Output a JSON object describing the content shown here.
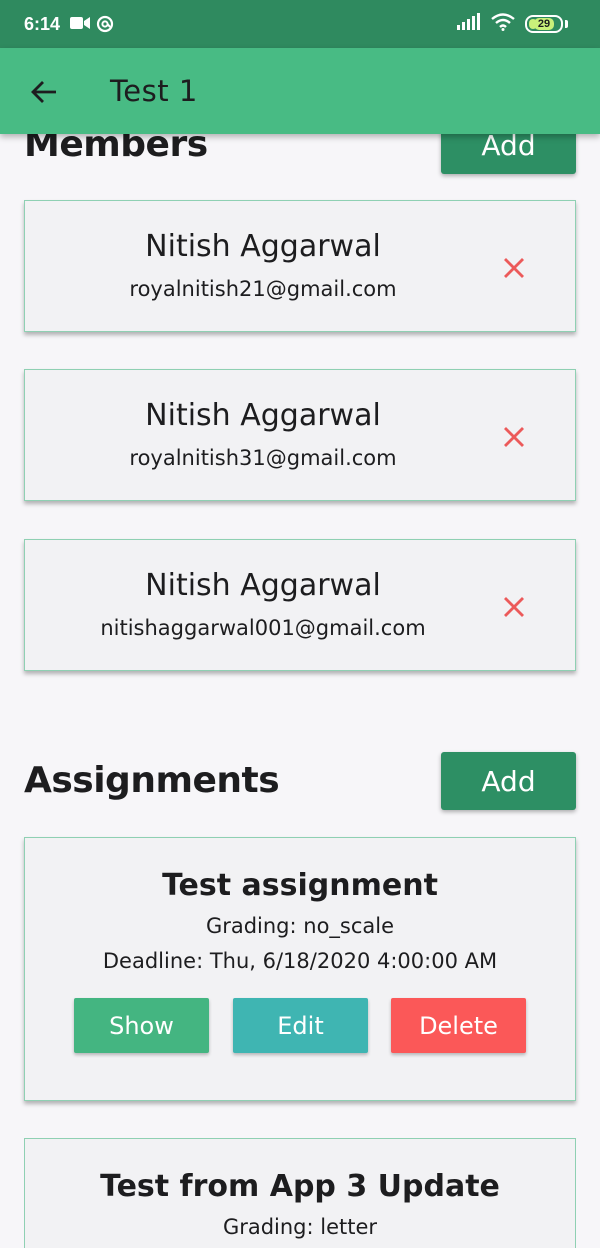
{
  "status_bar": {
    "time": "6:14",
    "battery_level": "29",
    "icons": [
      "video-camera-icon",
      "at-sign-icon",
      "signal-icon",
      "wifi-icon",
      "battery-icon"
    ]
  },
  "app_bar": {
    "back_icon": "arrow-left-icon",
    "title": "Test  1"
  },
  "members": {
    "title": "Members",
    "add_label": "Add",
    "items": [
      {
        "name": "Nitish Aggarwal",
        "email": "royalnitish21@gmail.com"
      },
      {
        "name": "Nitish Aggarwal",
        "email": "royalnitish31@gmail.com"
      },
      {
        "name": "Nitish Aggarwal",
        "email": "nitishaggarwal001@gmail.com"
      }
    ],
    "remove_icon": "close-icon"
  },
  "assignments": {
    "title": "Assignments",
    "add_label": "Add",
    "items": [
      {
        "title": "Test assignment",
        "grading": "Grading: no_scale",
        "deadline": "Deadline: Thu, 6/18/2020 4:00:00 AM",
        "show_label": "Show",
        "edit_label": "Edit",
        "delete_label": "Delete"
      },
      {
        "title": "Test from App 3 Update",
        "grading": "Grading: letter"
      }
    ]
  },
  "colors": {
    "status_bar": "#2f8a5f",
    "app_bar": "#48bb84",
    "add_button": "#2d8f64",
    "show_button": "#44b581",
    "edit_button": "#3fb5b2",
    "delete_button": "#fb5858",
    "remove_icon": "#ec5a5a",
    "card_border": "#8fd0b3"
  }
}
